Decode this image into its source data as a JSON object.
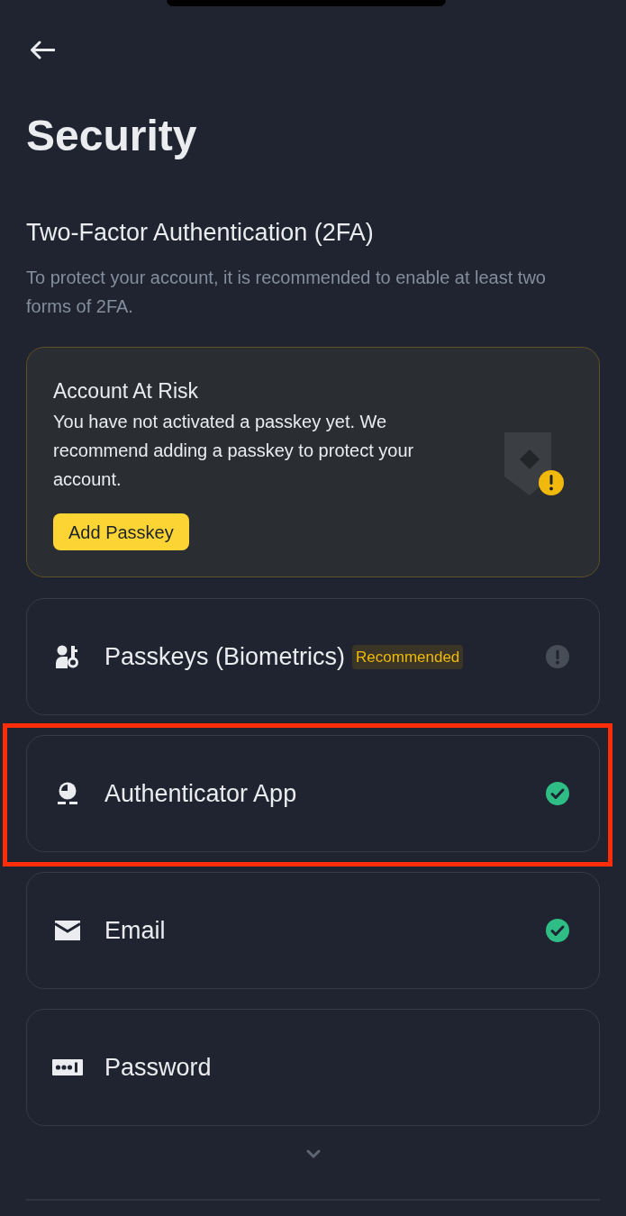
{
  "page": {
    "title": "Security"
  },
  "section": {
    "heading": "Two-Factor Authentication (2FA)",
    "description": "To protect your account, it is recommended to enable at least two forms of 2FA."
  },
  "alert": {
    "title": "Account At Risk",
    "message": "You have not activated a passkey yet. We recommend adding a passkey to protect your account.",
    "button": "Add Passkey"
  },
  "methods": [
    {
      "kind": "passkey",
      "label": "Passkeys (Biometrics)",
      "badge": "Recommended",
      "enabled": false,
      "warning": true,
      "highlighted": false
    },
    {
      "kind": "authenticator",
      "label": "Authenticator App",
      "enabled": true,
      "warning": false,
      "highlighted": true
    },
    {
      "kind": "email",
      "label": "Email",
      "enabled": true,
      "warning": false,
      "highlighted": false
    },
    {
      "kind": "password",
      "label": "Password",
      "enabled": false,
      "warning": false,
      "highlighted": false
    }
  ]
}
